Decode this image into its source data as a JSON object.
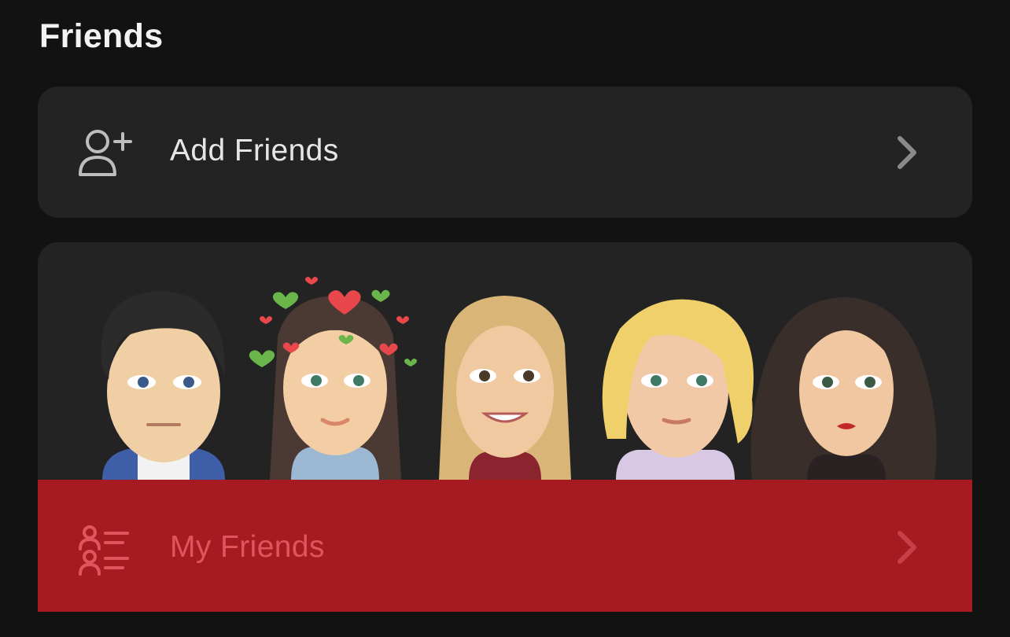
{
  "header": {
    "title": "Friends"
  },
  "add_friends": {
    "label": "Add Friends",
    "icon": "add-user-icon",
    "chevron": "chevron-right-icon"
  },
  "my_friends": {
    "label": "My Friends",
    "icon": "friends-list-icon",
    "chevron": "chevron-right-icon",
    "highlight_color": "#a61a22"
  },
  "avatars": [
    {
      "name": "avatar-1",
      "hair": "#2b2b2b",
      "shirt": "#3e5fa8"
    },
    {
      "name": "avatar-2",
      "hair": "#4a3a33",
      "shirt": "#9cb8d2",
      "hearts": true
    },
    {
      "name": "avatar-3",
      "hair": "#d9b678",
      "shirt": "#8a2530"
    },
    {
      "name": "avatar-4",
      "hair": "#f0d06a",
      "shirt": "#d8c8e4"
    },
    {
      "name": "avatar-5",
      "hair": "#3a2e2a",
      "shirt": "#2a2222"
    }
  ]
}
